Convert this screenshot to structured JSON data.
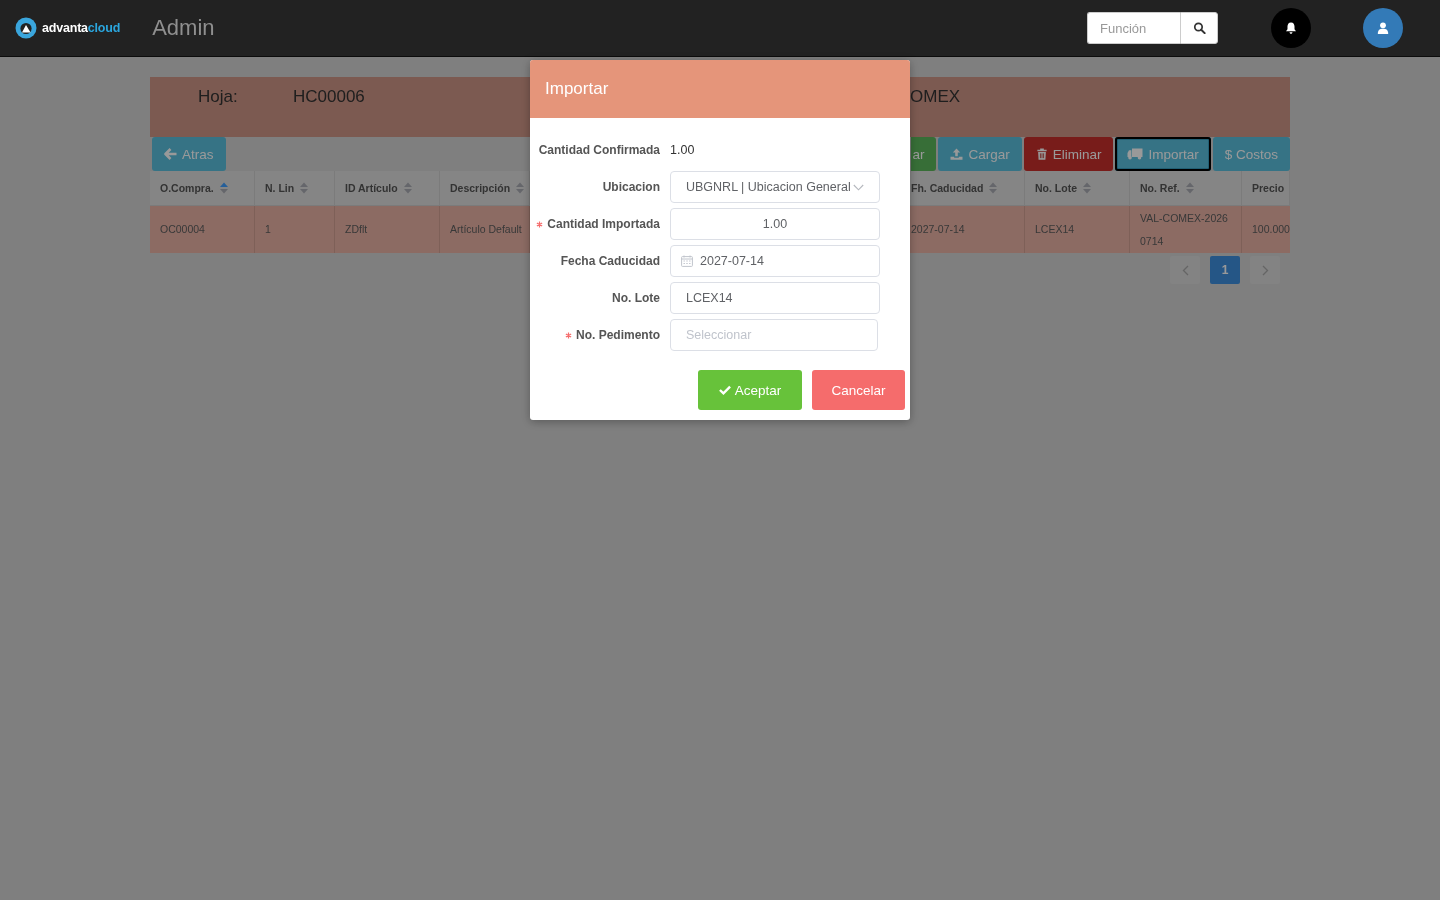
{
  "navbar": {
    "brand": [
      {
        "text": "advanta",
        "color": "#ffffff"
      },
      {
        "text": "cloud",
        "color": "#2ba6de"
      }
    ],
    "title": "Admin",
    "search": {
      "placeholder": "Función"
    }
  },
  "sheet": {
    "label": "Hoja:",
    "value": "HC00006",
    "extra": "OMEX"
  },
  "toolbar": {
    "back": {
      "label": "Atras"
    },
    "buttons": [
      {
        "label": "ar",
        "kind": "success",
        "focused": false
      },
      {
        "label": "Cargar",
        "kind": "upload",
        "focused": false
      },
      {
        "label": "Eliminar",
        "kind": "delete",
        "focused": false
      },
      {
        "label": "Importar",
        "kind": "import",
        "focused": true
      },
      {
        "label": "$ Costos",
        "kind": "costs",
        "focused": false
      }
    ]
  },
  "table": {
    "columns": [
      {
        "label": "O.Compra.",
        "sorted": true
      },
      {
        "label": "N. Lin",
        "sorted": false
      },
      {
        "label": "ID Artículo",
        "sorted": false
      },
      {
        "label": "Descripción",
        "sorted": false
      },
      {
        "label": "Fh. Caducidad",
        "sorted": false
      },
      {
        "label": "No. Lote",
        "sorted": false
      },
      {
        "label": "No. Ref.",
        "sorted": false
      },
      {
        "label": "Precio"
      }
    ],
    "rows": [
      {
        "cells": [
          "OC00004",
          "1",
          "ZDflt",
          "Artículo Default",
          "2027-07-14",
          "LCEX14",
          "VAL-COMEX-20260714",
          "100.000"
        ]
      }
    ]
  },
  "pagination": {
    "pages": [
      {
        "label": "1",
        "selected": true
      }
    ]
  },
  "modal": {
    "title": "Importar",
    "fields": [
      {
        "kind": "text",
        "label": "Cantidad Confirmada",
        "required": false,
        "value": "1.00"
      },
      {
        "kind": "select",
        "label": "Ubicacion",
        "required": false,
        "value": "UBGNRL | Ubicacion General"
      },
      {
        "kind": "number",
        "label": "Cantidad Importada",
        "required": true,
        "value": "1.00"
      },
      {
        "kind": "date",
        "label": "Fecha Caducidad",
        "required": false,
        "value": "2027-07-14"
      },
      {
        "kind": "input",
        "label": "No. Lote",
        "required": false,
        "value": "LCEX14"
      },
      {
        "kind": "search-select",
        "label": "No. Pedimento",
        "required": true,
        "placeholder": "Seleccionar"
      }
    ],
    "buttons": [
      {
        "label": "Aceptar",
        "kind": "confirm"
      },
      {
        "label": "Cancelar",
        "kind": "cancel"
      }
    ]
  }
}
